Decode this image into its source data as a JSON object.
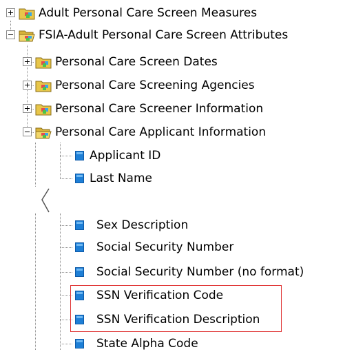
{
  "tree": {
    "nodes": [
      {
        "label": "Adult Personal Care Screen Measures",
        "type": "folder",
        "state": "collapsed"
      },
      {
        "label": "FSIA-Adult Personal Care Screen Attributes",
        "type": "folder",
        "state": "expanded"
      },
      {
        "label": "Personal Care Screen Dates",
        "type": "folder",
        "state": "collapsed"
      },
      {
        "label": "Personal Care Screening Agencies",
        "type": "folder",
        "state": "collapsed"
      },
      {
        "label": "Personal Care Screener Information",
        "type": "folder",
        "state": "collapsed"
      },
      {
        "label": "Personal Care Applicant Information",
        "type": "folder",
        "state": "expanded"
      },
      {
        "label": "Applicant ID",
        "type": "field"
      },
      {
        "label": "Last Name",
        "type": "field"
      },
      {
        "label": "Sex Description",
        "type": "field"
      },
      {
        "label": "Social Security Number",
        "type": "field"
      },
      {
        "label": "Social Security Number (no format)",
        "type": "field"
      },
      {
        "label": "SSN Verification Code",
        "type": "field"
      },
      {
        "label": "SSN Verification Description",
        "type": "field"
      },
      {
        "label": "State Alpha Code",
        "type": "field"
      }
    ],
    "highlighted": [
      "SSN Verification Code",
      "SSN Verification Description"
    ]
  },
  "colors": {
    "highlight_border": "#e03333",
    "field_icon": "#1e7fd6",
    "folder_body": "#e8c64a",
    "tree_lines": "#8c8c8c"
  }
}
